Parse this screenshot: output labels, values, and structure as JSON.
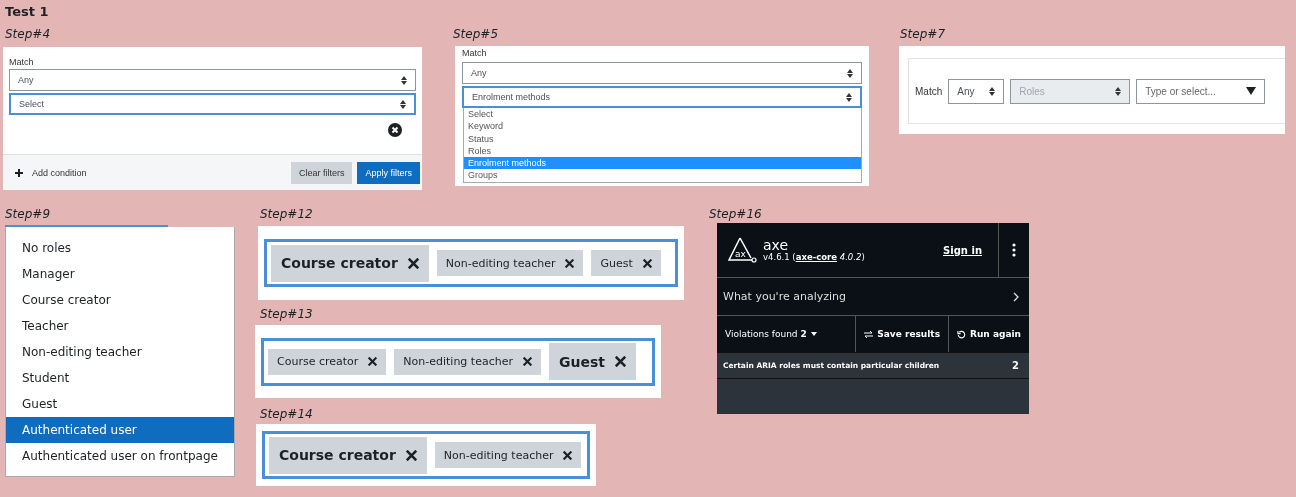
{
  "title": "Test 1",
  "steps": [
    {
      "kind": "filter_form",
      "label": "Step#4",
      "match_label": "Match",
      "match_select": {
        "value": "Any",
        "focused": false
      },
      "field_select": {
        "value": "Select",
        "focused": true
      },
      "add_condition": "Add condition",
      "buttons": [
        {
          "label": "Clear filters",
          "kind": "secondary"
        },
        {
          "label": "Apply filters",
          "kind": "primary"
        }
      ]
    },
    {
      "kind": "dropdown_open",
      "label": "Step#5",
      "match_label": "Match",
      "match_select": {
        "value": "Any",
        "focused": false
      },
      "field_select": {
        "value": "Enrolment methods",
        "focused": true
      },
      "options": [
        {
          "label": "Select",
          "selected": false
        },
        {
          "label": "Keyword",
          "selected": false
        },
        {
          "label": "Status",
          "selected": false
        },
        {
          "label": "Roles",
          "selected": false
        },
        {
          "label": "Enrolment methods",
          "selected": true
        },
        {
          "label": "Groups",
          "selected": false
        }
      ]
    },
    {
      "kind": "inline_row",
      "label": "Step#7",
      "match_label": "Match",
      "match_select": {
        "value": "Any",
        "disabled": false
      },
      "field_select": {
        "value": "Roles",
        "disabled": true
      },
      "search": {
        "placeholder": "Type or select..."
      }
    },
    {
      "kind": "role_list",
      "label": "Step#9",
      "options": [
        {
          "label": "No roles",
          "selected": false
        },
        {
          "label": "Manager",
          "selected": false
        },
        {
          "label": "Course creator",
          "selected": false
        },
        {
          "label": "Teacher",
          "selected": false
        },
        {
          "label": "Non-editing teacher",
          "selected": false
        },
        {
          "label": "Student",
          "selected": false
        },
        {
          "label": "Guest",
          "selected": false
        },
        {
          "label": "Authenticated user",
          "selected": true
        },
        {
          "label": "Authenticated user on frontpage",
          "selected": false
        }
      ]
    },
    {
      "kind": "chips",
      "label": "Step#12",
      "chips": [
        {
          "label": "Course creator",
          "focused": true
        },
        {
          "label": "Non-editing teacher",
          "focused": false
        },
        {
          "label": "Guest",
          "focused": false
        }
      ]
    },
    {
      "kind": "chips",
      "label": "Step#13",
      "chips": [
        {
          "label": "Course creator",
          "focused": false
        },
        {
          "label": "Non-editing teacher",
          "focused": false
        },
        {
          "label": "Guest",
          "focused": true
        }
      ]
    },
    {
      "kind": "chips",
      "label": "Step#14",
      "chips": [
        {
          "label": "Course creator",
          "focused": true
        },
        {
          "label": "Non-editing teacher",
          "focused": false
        }
      ]
    },
    {
      "kind": "axe",
      "label": "Step#16",
      "logo_text": "ax",
      "name": "axe",
      "version_prefix": "v4.6.1 (",
      "core_link": "axe-core",
      "core_version": "4.0.2",
      "version_suffix": ")",
      "sign_in": "Sign in",
      "analyzing": "What you're analyzing",
      "violations": "Violations found **2**",
      "save": "Save results",
      "run": "Run again",
      "issues": [
        {
          "text": "Certain ARIA roles must contain particular children",
          "count": "2"
        }
      ]
    }
  ]
}
